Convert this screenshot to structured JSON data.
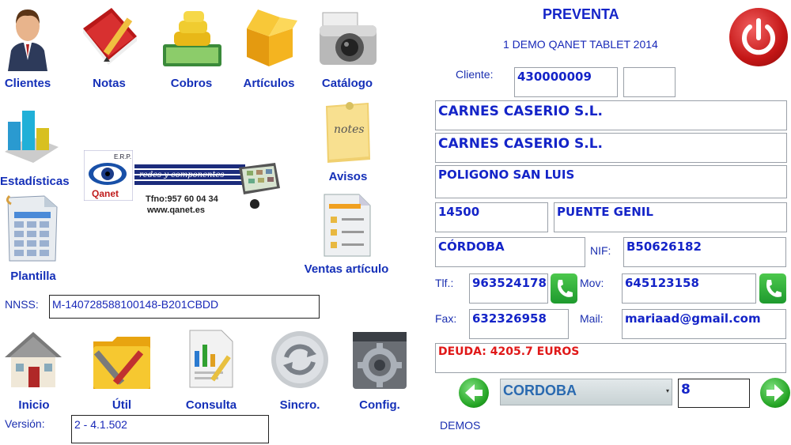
{
  "toolbar": {
    "clientes": "Clientes",
    "notas": "Notas",
    "cobros": "Cobros",
    "articulos": "Artículos",
    "catalogo": "Catálogo",
    "estadisticas": "Estadísticas",
    "avisos": "Avisos",
    "plantilla": "Plantilla",
    "ventas_articulo": "Ventas artículo",
    "inicio": "Inicio",
    "util": "Útil",
    "consulta": "Consulta",
    "sincro": "Sincro.",
    "config": "Config."
  },
  "logo": {
    "erp": "E.R.P.",
    "brand": "Qanet",
    "tagline": "redes y componentes",
    "phone": "Tfno:957 60 04 34",
    "web": "www.qanet.es"
  },
  "nnss": {
    "label": "NNSS:",
    "value": "M-140728588100148-B201CBDD"
  },
  "version": {
    "label": "Versión:",
    "value": "2 - 4.1.502"
  },
  "header": {
    "title": "PREVENTA",
    "subtitle": "1 DEMO QANET TABLET 2014"
  },
  "client": {
    "label": "Cliente:",
    "code": "430000009",
    "code2": "",
    "name1": "CARNES CASERIO S.L.",
    "name2": "CARNES CASERIO S.L.",
    "address": "POLIGONO SAN LUIS",
    "zip": "14500",
    "city": "PUENTE GENIL",
    "province": "CÓRDOBA",
    "nif_label": "NIF:",
    "nif": "B50626182",
    "tlf_label": "Tlf.:",
    "tlf": "963524178",
    "mov_label": "Mov:",
    "mov": "645123158",
    "fax_label": "Fax:",
    "fax": "632326958",
    "mail_label": "Mail:",
    "mail": "mariaad@gmail.com",
    "debt": "DEUDA: 4205.7 EUROS"
  },
  "nav": {
    "route": "CORDOBA",
    "number": "8",
    "footer": "DEMOS"
  },
  "colors": {
    "accent": "#1424c8",
    "debt": "#e01818",
    "power": "#d42020",
    "nav_green": "#2aa82a"
  }
}
